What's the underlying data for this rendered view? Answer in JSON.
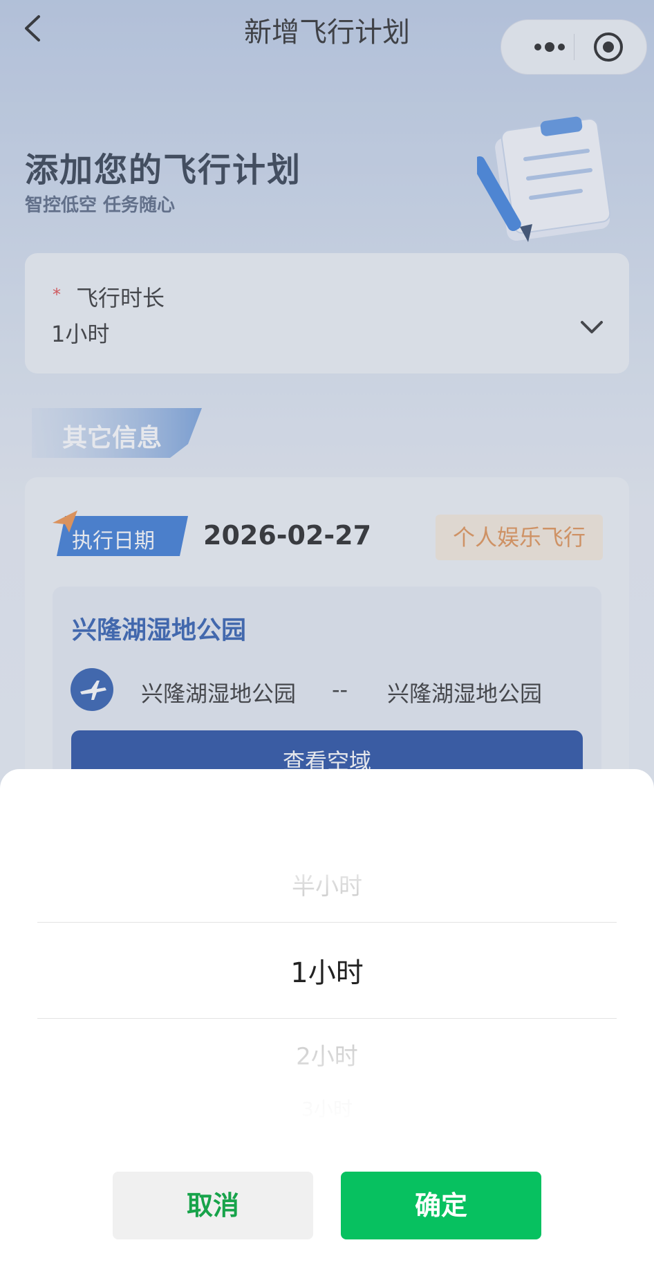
{
  "header": {
    "title": "新增飞行计划"
  },
  "hero": {
    "title": "添加您的飞行计划",
    "subtitle": "智控低空 任务随心"
  },
  "duration": {
    "required_mark": "*",
    "label": "飞行时长",
    "value": "1小时"
  },
  "section": {
    "title": "其它信息"
  },
  "plan": {
    "date_label": "执行日期",
    "date_value": "2026-02-27",
    "type": "个人娱乐飞行",
    "route": {
      "title": "兴隆湖湿地公园",
      "from": "兴隆湖湿地公园",
      "separator": "--",
      "to": "兴隆湖湿地公园",
      "view_button": "查看空域"
    }
  },
  "picker": {
    "options": [
      "半小时",
      "1小时",
      "2小时",
      "3小时"
    ],
    "selected": "1小时",
    "cancel_label": "取消",
    "confirm_label": "确定"
  },
  "colors": {
    "accent_blue": "#123f9a",
    "route_title_blue": "#1e4fa8",
    "confirm_green": "#07c160",
    "cancel_text_green": "#17a34a",
    "badge_orange": "#e08a44",
    "required_red": "#e03a3a"
  },
  "icons": [
    "back-icon",
    "more-icon",
    "target-icon",
    "clipboard-pen-icon",
    "chevron-down-icon",
    "paper-plane-icon",
    "airplane-icon"
  ]
}
